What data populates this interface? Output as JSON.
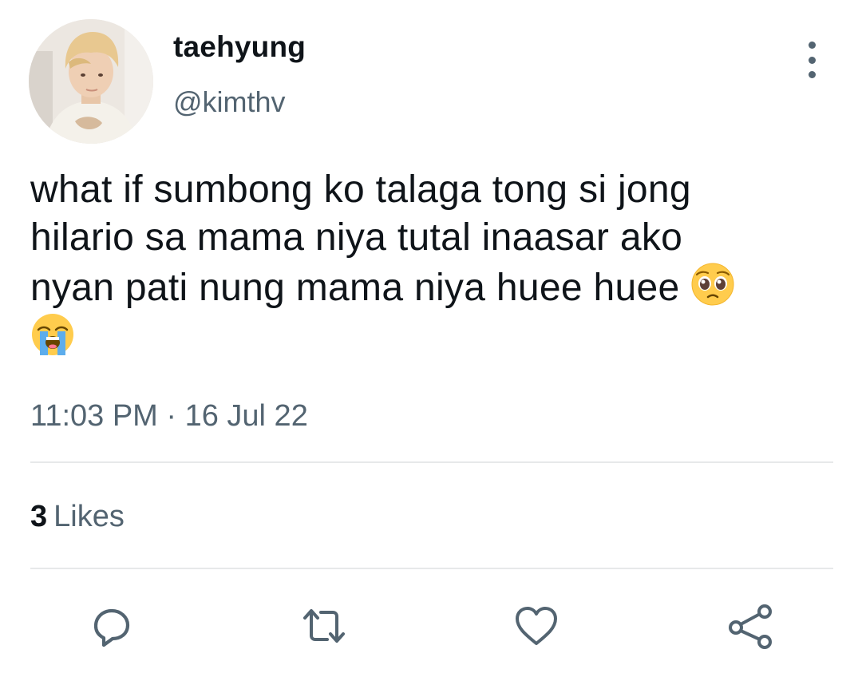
{
  "author": {
    "display_name": "taehyung",
    "handle": "@kimthv"
  },
  "tweet": {
    "text_line_1": "what if sumbong ko talaga tong si jong",
    "text_line_2": "hilario sa mama niya tutal inaasar ako",
    "text_line_3": "nyan pati nung mama niya huee huee",
    "emoji_1": "pleading-face",
    "emoji_2": "loudly-crying-face",
    "timestamp": "11:03 PM · 16 Jul 22"
  },
  "stats": {
    "likes_count": "3",
    "likes_label": "Likes"
  },
  "actions": [
    {
      "name": "reply",
      "icon": "reply-icon"
    },
    {
      "name": "retweet",
      "icon": "retweet-icon"
    },
    {
      "name": "like",
      "icon": "heart-icon"
    },
    {
      "name": "share",
      "icon": "share-icon"
    }
  ],
  "colors": {
    "text_primary": "#0f1419",
    "text_secondary": "#536471",
    "divider": "#e7e9ea"
  }
}
